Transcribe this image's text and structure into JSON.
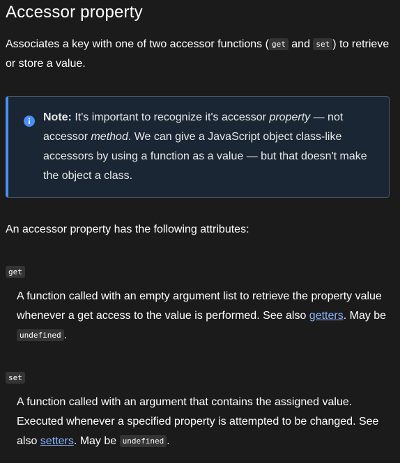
{
  "heading": "Accessor property",
  "intro": {
    "before_get": "Associates a key with one of two accessor functions (",
    "get_code": "get",
    "between": " and ",
    "set_code": "set",
    "after_set": ") to retrieve or store a value."
  },
  "note": {
    "label": "Note:",
    "text_1": " It's important to recognize it's accessor ",
    "em_1": "property",
    "text_2": " — not accessor ",
    "em_2": "method",
    "text_3": ". We can give a JavaScript object class-like accessors by using a function as a value — but that doesn't make the object a class."
  },
  "attributes_intro": "An accessor property has the following attributes:",
  "attributes": [
    {
      "term": "get",
      "desc_before": "A function called with an empty argument list to retrieve the property value whenever a get access to the value is performed. See also ",
      "link_text": "getters",
      "desc_after": ". May be ",
      "code": "undefined",
      "end": "."
    },
    {
      "term": "set",
      "desc_before": "A function called with an argument that contains the assigned value. Executed whenever a specified property is attempted to be changed. See also ",
      "link_text": "setters",
      "desc_after": ". May be ",
      "code": "undefined",
      "end": "."
    }
  ],
  "colors": {
    "background": "#1b1b1b",
    "note_background": "#1a2633",
    "note_accent": "#4a8ff6",
    "link": "#8cb4ff"
  }
}
